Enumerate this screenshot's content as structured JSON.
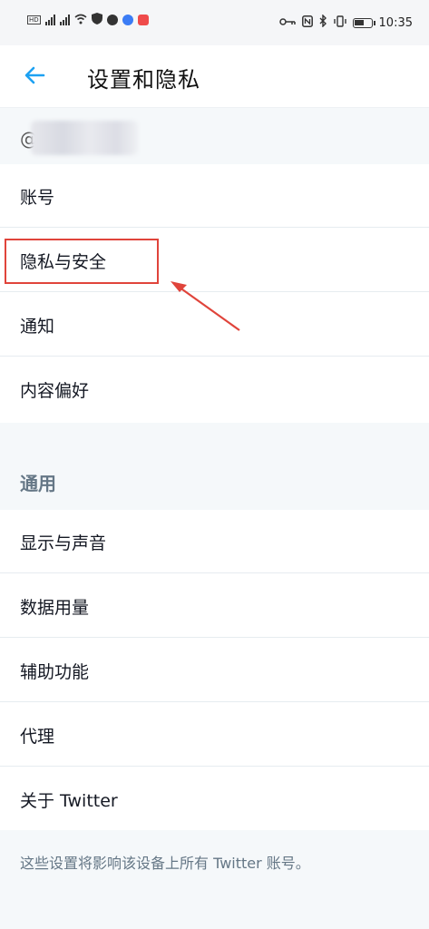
{
  "status_bar": {
    "time": "10:35",
    "left_icons": [
      "hd-badge",
      "signal-4g",
      "signal-5g",
      "wifi-icon",
      "shield-icon",
      "app-icon",
      "music-icon",
      "app-red-icon"
    ],
    "right_icons": [
      "key-icon",
      "nfc-icon",
      "bluetooth-icon",
      "vibrate-icon",
      "battery-icon"
    ]
  },
  "header": {
    "back_icon": "arrow-left-icon",
    "title": "设置和隐私"
  },
  "account": {
    "handle_prefix": "@"
  },
  "menu_top": [
    {
      "label": "账号"
    },
    {
      "label": "隐私与安全"
    },
    {
      "label": "通知"
    },
    {
      "label": "内容偏好"
    }
  ],
  "general": {
    "section_title": "通用",
    "items": [
      {
        "label": "显示与声音"
      },
      {
        "label": "数据用量"
      },
      {
        "label": "辅助功能"
      },
      {
        "label": "代理"
      },
      {
        "label": "关于 Twitter"
      }
    ]
  },
  "footer": {
    "note": "这些设置将影响该设备上所有 Twitter 账号。"
  },
  "colors": {
    "accent": "#1da1f2",
    "highlight": "#e0443b",
    "section_bg": "#f5f8fa",
    "muted_text": "#657786"
  }
}
